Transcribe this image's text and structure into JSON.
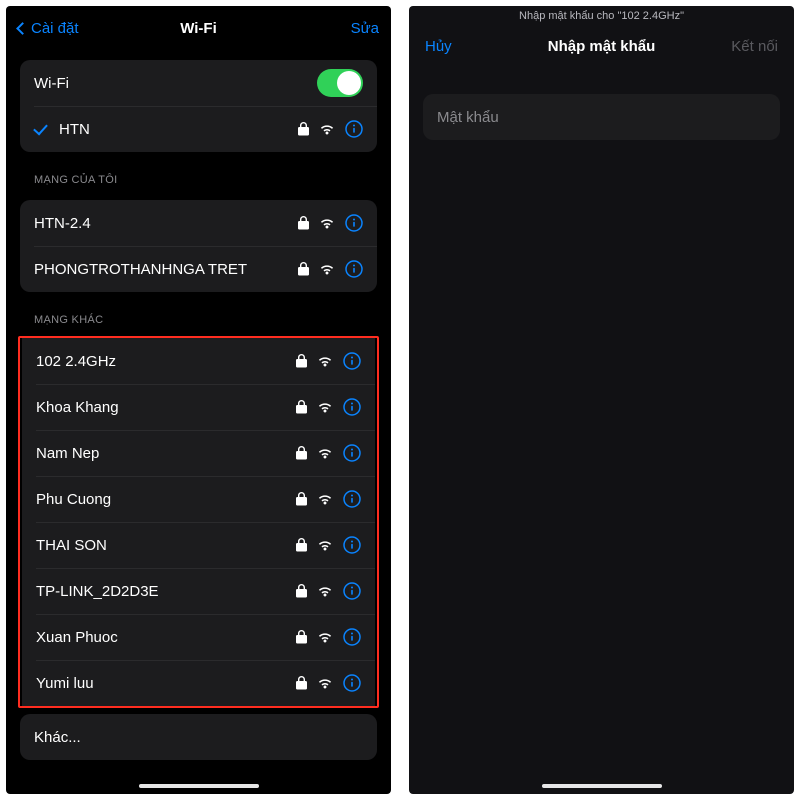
{
  "colors": {
    "accent": "#0a84ff",
    "toggleOn": "#30d158",
    "cell": "#1c1c1e",
    "highlight": "#ff2d20"
  },
  "left": {
    "nav": {
      "back": "Cài đặt",
      "title": "Wi-Fi",
      "edit": "Sửa"
    },
    "wifiToggle": {
      "label": "Wi-Fi",
      "on": true
    },
    "connected": {
      "name": "HTN",
      "secure": true
    },
    "sectionMyNetworks": "MẠNG CỦA TÔI",
    "myNetworks": [
      {
        "name": "HTN-2.4",
        "secure": true
      },
      {
        "name": "PHONGTROTHANHNGA TRET",
        "secure": true
      }
    ],
    "sectionOther": "MẠNG KHÁC",
    "otherNetworks": [
      {
        "name": "102 2.4GHz",
        "secure": true
      },
      {
        "name": "Khoa Khang",
        "secure": true
      },
      {
        "name": "Nam Nep",
        "secure": true
      },
      {
        "name": "Phu Cuong",
        "secure": true
      },
      {
        "name": "THAI SON",
        "secure": true
      },
      {
        "name": "TP-LINK_2D2D3E",
        "secure": true
      },
      {
        "name": "Xuan Phuoc",
        "secure": true
      },
      {
        "name": "Yumi luu",
        "secure": true
      }
    ],
    "otherLabel": "Khác..."
  },
  "right": {
    "subtitle": "Nhập mật khẩu cho \"102 2.4GHz\"",
    "nav": {
      "cancel": "Hủy",
      "title": "Nhập mật khẩu",
      "join": "Kết nối"
    },
    "passwordPlaceholder": "Mật khẩu"
  }
}
